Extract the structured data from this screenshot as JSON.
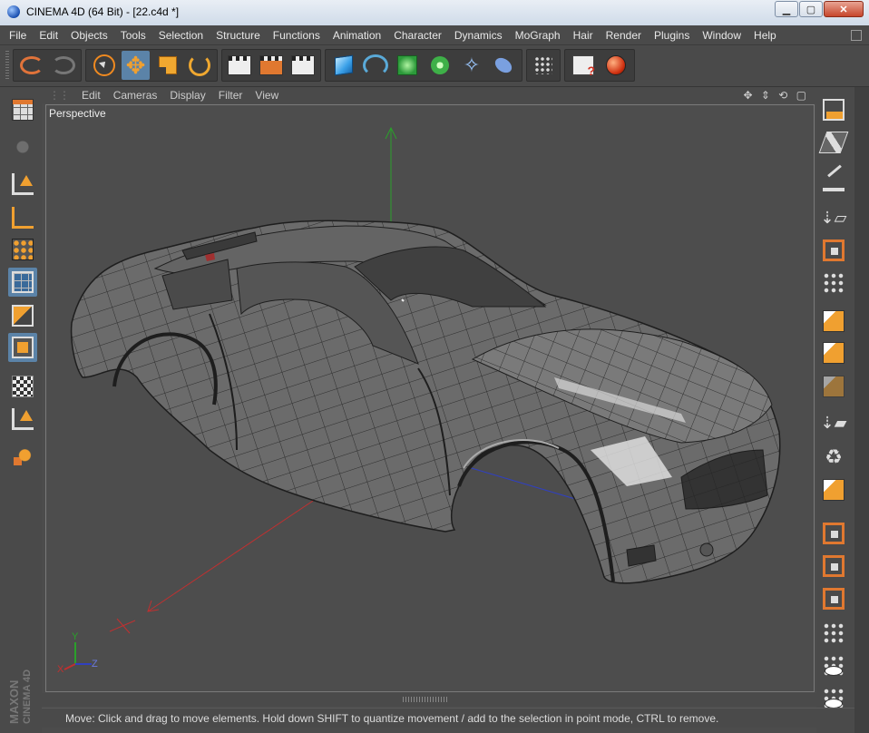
{
  "window": {
    "title": "CINEMA 4D (64 Bit) - [22.c4d *]",
    "min_label": "▁",
    "max_label": "▢",
    "close_label": "✕"
  },
  "menubar": {
    "items": [
      "File",
      "Edit",
      "Objects",
      "Tools",
      "Selection",
      "Structure",
      "Functions",
      "Animation",
      "Character",
      "Dynamics",
      "MoGraph",
      "Hair",
      "Render",
      "Plugins",
      "Window",
      "Help"
    ]
  },
  "toolbar": {
    "icons": [
      "undo-icon",
      "redo-icon",
      "live-selection-icon",
      "move-icon",
      "scale-icon",
      "rotate-icon",
      "render-view-icon",
      "render-picture-viewer-icon",
      "edit-render-settings-icon",
      "cube-primitive-icon",
      "spline-icon",
      "nurbs-icon",
      "array-icon",
      "deformer-icon",
      "environment-icon",
      "particle-icon",
      "scene-settings-icon",
      "render-active-icon"
    ]
  },
  "viewport": {
    "menu": [
      "Edit",
      "Cameras",
      "Display",
      "Filter",
      "View"
    ],
    "nav_icons": "✥ ⇕ ⟲ ▢",
    "label": "Perspective",
    "axes": {
      "y": "Y",
      "x": "X",
      "z": "Z"
    },
    "colors": {
      "background": "#4d4d4d",
      "mesh": "#707070",
      "wire": "#1e1e1e",
      "axis_y": "#2aa02a",
      "axis_x": "#c03030",
      "axis_z": "#3040c0"
    }
  },
  "branding": {
    "line1": "MAXON",
    "line2": "CINEMA 4D"
  },
  "statusbar": {
    "text": "Move: Click and drag to move elements. Hold down SHIFT to quantize movement / add to the selection in point mode, CTRL to remove."
  },
  "accent_color": "#5b83a8",
  "highlight_color": "#f0a030"
}
